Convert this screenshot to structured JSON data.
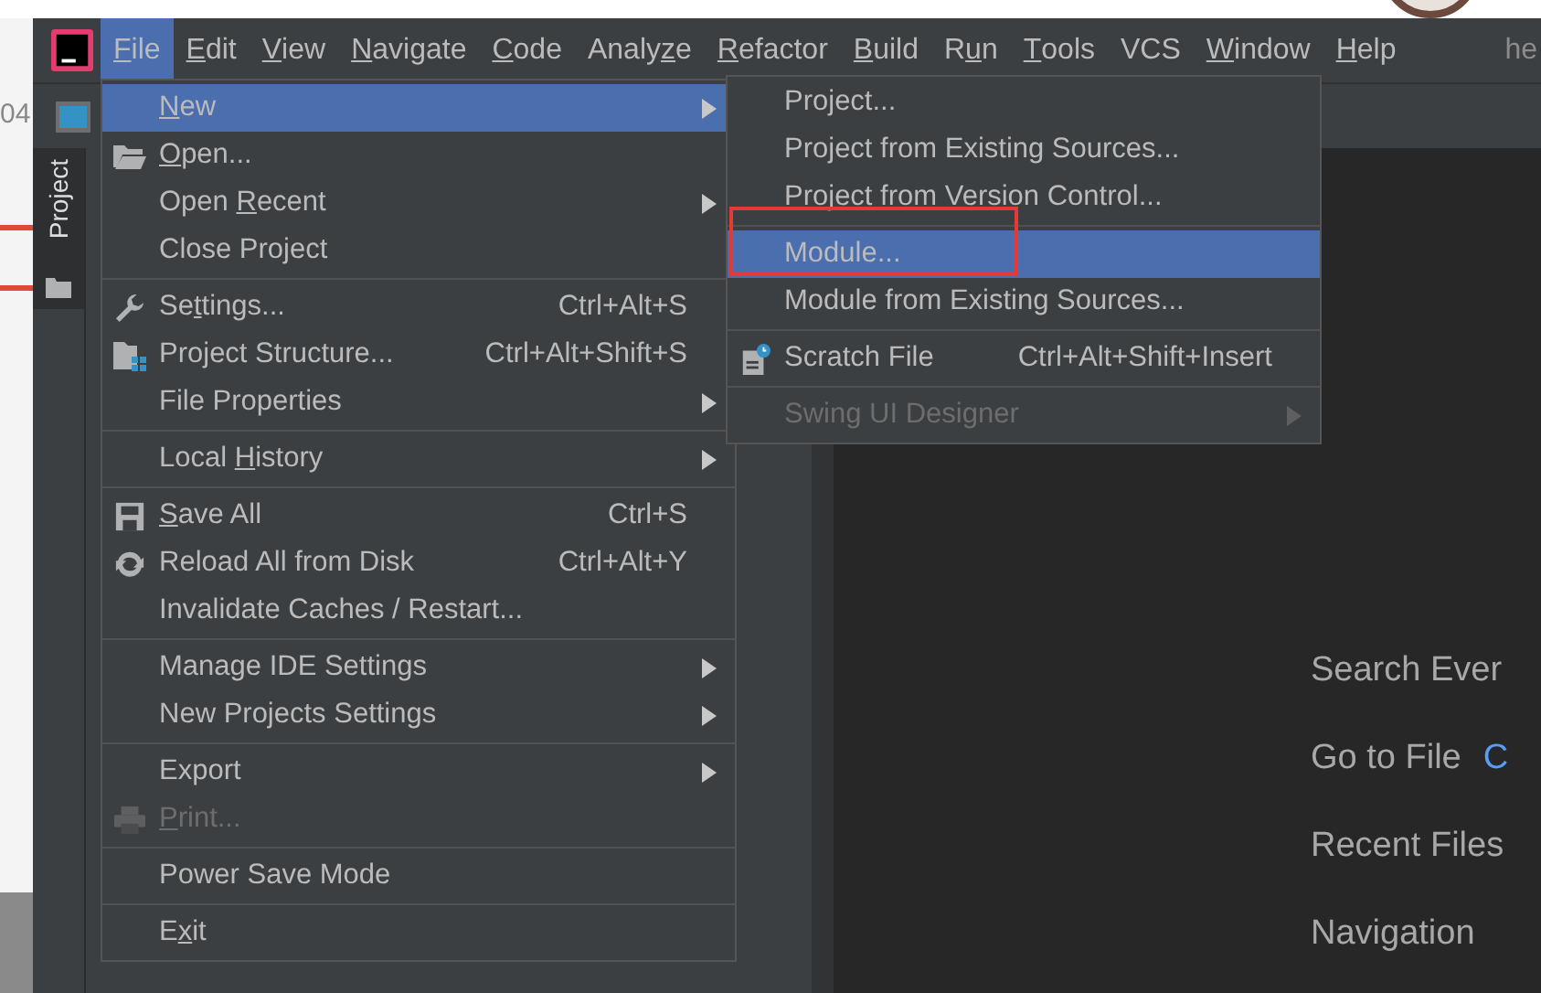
{
  "background_window": {
    "fragments": [
      "04"
    ]
  },
  "menu_bar": {
    "items": [
      {
        "label": {
          "key": "F",
          "post": "ile"
        },
        "selected": true
      },
      {
        "label": {
          "key": "E",
          "post": "dit"
        },
        "selected": false
      },
      {
        "label": {
          "key": "V",
          "post": "iew"
        },
        "selected": false
      },
      {
        "label": {
          "key": "N",
          "post": "avigate"
        },
        "selected": false
      },
      {
        "label": {
          "key": "C",
          "post": "ode"
        },
        "selected": false
      },
      {
        "label": {
          "pre": "Analy",
          "key": "z",
          "post": "e"
        },
        "selected": false
      },
      {
        "label": {
          "key": "R",
          "post": "efactor"
        },
        "selected": false
      },
      {
        "label": {
          "key": "B",
          "post": "uild"
        },
        "selected": false
      },
      {
        "label": {
          "pre": "R",
          "key": "u",
          "post": "n"
        },
        "selected": false
      },
      {
        "label": {
          "key": "T",
          "post": "ools"
        },
        "selected": false
      },
      {
        "label": "VCS",
        "selected": false
      },
      {
        "label": {
          "key": "W",
          "post": "indow"
        },
        "selected": false
      },
      {
        "label": {
          "key": "H",
          "post": "elp"
        },
        "selected": false
      }
    ],
    "title_fragment": "he"
  },
  "tool_window_tab": {
    "label": "Project",
    "selected": true
  },
  "file_menu": {
    "items": [
      {
        "kind": "item",
        "label": {
          "key": "N",
          "post": "ew"
        },
        "submenu": true,
        "selected": true,
        "disabled": false
      },
      {
        "kind": "item",
        "label": {
          "key": "O",
          "post": "pen..."
        },
        "icon": true,
        "submenu": false,
        "selected": false,
        "disabled": false
      },
      {
        "kind": "item",
        "label": {
          "pre": "Open ",
          "key": "R",
          "post": "ecent"
        },
        "submenu": true,
        "selected": false,
        "disabled": false
      },
      {
        "kind": "item",
        "label": "Close Project",
        "submenu": false,
        "selected": false,
        "disabled": false
      },
      {
        "kind": "separator"
      },
      {
        "kind": "item",
        "label": {
          "pre": "Se",
          "key": "t",
          "post": "tings..."
        },
        "icon": true,
        "shortcut": "Ctrl+Alt+S",
        "submenu": false,
        "selected": false,
        "disabled": false
      },
      {
        "kind": "item",
        "label": "Project Structure...",
        "icon": true,
        "shortcut": "Ctrl+Alt+Shift+S",
        "submenu": false,
        "selected": false,
        "disabled": false
      },
      {
        "kind": "item",
        "label": "File Properties",
        "submenu": true,
        "selected": false,
        "disabled": false
      },
      {
        "kind": "separator"
      },
      {
        "kind": "item",
        "label": {
          "pre": "Local ",
          "key": "H",
          "post": "istory"
        },
        "submenu": true,
        "selected": false,
        "disabled": false
      },
      {
        "kind": "separator"
      },
      {
        "kind": "item",
        "label": {
          "key": "S",
          "post": "ave All"
        },
        "icon": true,
        "shortcut": "Ctrl+S",
        "submenu": false,
        "selected": false,
        "disabled": false
      },
      {
        "kind": "item",
        "label": "Reload All from Disk",
        "icon": true,
        "shortcut": "Ctrl+Alt+Y",
        "submenu": false,
        "selected": false,
        "disabled": false
      },
      {
        "kind": "item",
        "label": "Invalidate Caches / Restart...",
        "submenu": false,
        "selected": false,
        "disabled": false
      },
      {
        "kind": "separator"
      },
      {
        "kind": "item",
        "label": "Manage IDE Settings",
        "submenu": true,
        "selected": false,
        "disabled": false
      },
      {
        "kind": "item",
        "label": "New Projects Settings",
        "submenu": true,
        "selected": false,
        "disabled": false
      },
      {
        "kind": "separator"
      },
      {
        "kind": "item",
        "label": "Export",
        "submenu": true,
        "selected": false,
        "disabled": false
      },
      {
        "kind": "item",
        "label": {
          "key": "P",
          "post": "rint..."
        },
        "icon": true,
        "submenu": false,
        "selected": false,
        "disabled": true
      },
      {
        "kind": "separator"
      },
      {
        "kind": "item",
        "label": "Power Save Mode",
        "submenu": false,
        "selected": false,
        "disabled": false
      },
      {
        "kind": "separator"
      },
      {
        "kind": "item",
        "label": {
          "pre": "E",
          "key": "x",
          "post": "it"
        },
        "submenu": false,
        "selected": false,
        "disabled": false
      }
    ]
  },
  "new_submenu": {
    "items": [
      {
        "kind": "item",
        "label": "Project...",
        "submenu": false,
        "selected": false,
        "disabled": false
      },
      {
        "kind": "item",
        "label": "Project from Existing Sources...",
        "submenu": false,
        "selected": false,
        "disabled": false
      },
      {
        "kind": "item",
        "label": "Project from Version Control...",
        "submenu": false,
        "selected": false,
        "disabled": false
      },
      {
        "kind": "separator"
      },
      {
        "kind": "item",
        "label": "Module...",
        "submenu": false,
        "selected": true,
        "disabled": false,
        "annotated": true
      },
      {
        "kind": "item",
        "label": "Module from Existing Sources...",
        "submenu": false,
        "selected": false,
        "disabled": false
      },
      {
        "kind": "separator"
      },
      {
        "kind": "item",
        "label": "Scratch File",
        "icon": true,
        "shortcut": "Ctrl+Alt+Shift+Insert",
        "submenu": false,
        "selected": false,
        "disabled": false
      },
      {
        "kind": "separator"
      },
      {
        "kind": "item",
        "label": "Swing UI Designer",
        "submenu": true,
        "selected": false,
        "disabled": true
      }
    ]
  },
  "welcome": {
    "lines": [
      {
        "text": "Search Ever"
      },
      {
        "text": "Go to File",
        "shortcut": "C"
      },
      {
        "text": "Recent Files"
      },
      {
        "text": "Navigation"
      }
    ]
  }
}
